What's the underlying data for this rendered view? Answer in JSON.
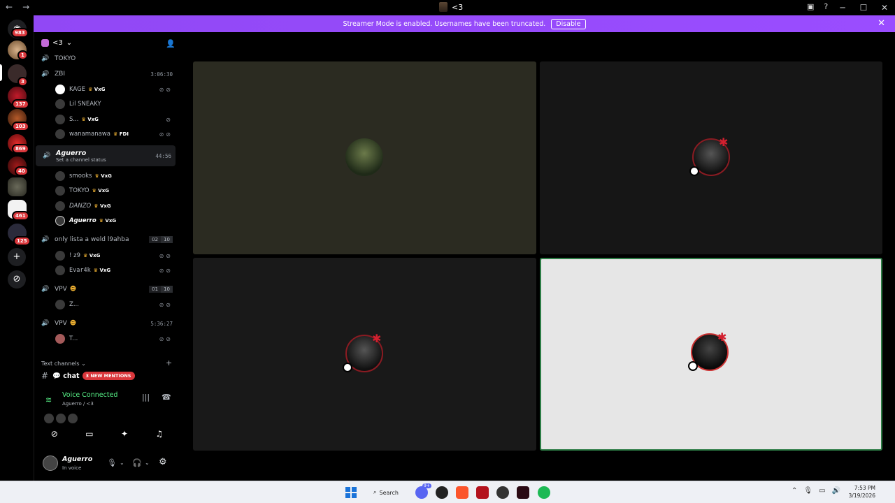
{
  "window": {
    "title": "<3",
    "nav_back": "←",
    "nav_forward": "→",
    "minimize": "─",
    "maximize": "☐",
    "close": "✕",
    "inbox_icon": "inbox-icon",
    "help_icon": "help-icon"
  },
  "banner": {
    "text": "Streamer Mode is enabled. Usernames have been truncated.",
    "disable_label": "Disable",
    "close": "✕",
    "color": "#9146ff"
  },
  "guild_rail": {
    "badges": [
      "983",
      "1",
      "3",
      "137",
      "103",
      "869",
      "40",
      "461",
      "125"
    ],
    "add_server": "+",
    "discover": "⊘"
  },
  "server": {
    "name": "<3",
    "chevron": "⌄",
    "invite_icon": "add-member-icon"
  },
  "channels": [
    {
      "name": "TOKYO",
      "kind": "partial"
    },
    {
      "name": "ZBI",
      "time": "3:06:30",
      "members": [
        {
          "name": "KAGE",
          "tag": "VxG"
        },
        {
          "name": "Lil SNEAKY",
          "tag": ""
        },
        {
          "name": "S...",
          "tag": "VxG"
        },
        {
          "name": "wanamanawa",
          "tag": "FDI"
        }
      ]
    },
    {
      "name": "Aguerro",
      "time": "44:56",
      "status": "Set a channel status",
      "members": [
        {
          "name": "smooks",
          "tag": "VxG"
        },
        {
          "name": "TOKYO",
          "tag": "VxG"
        },
        {
          "name": "DANZO",
          "tag": "VxG"
        },
        {
          "name": "Aguerro",
          "tag": "VxG"
        }
      ]
    },
    {
      "name": "only lista a weld l9ahba",
      "limit": [
        "02",
        "10"
      ],
      "members": [
        {
          "name": "! ᴢ9",
          "tag": "VxG"
        },
        {
          "name": "Evar4k",
          "tag": "VxG"
        }
      ]
    },
    {
      "name": "VPV",
      "limit": [
        "01",
        "10"
      ],
      "members": [
        {
          "name": "Z...",
          "tag": ""
        }
      ]
    },
    {
      "name": "VPV",
      "time": "5:36:27",
      "members": [
        {
          "name": "T...",
          "tag": ""
        }
      ]
    }
  ],
  "text_category": {
    "label": "Text channels",
    "plus": "+",
    "chat_name": "💬 chat",
    "mention_badge": "3 NEW MENTIONS",
    "hash": "#"
  },
  "voice": {
    "title": "Voice Connected",
    "subtitle": "Aguerro / <3"
  },
  "user_panel": {
    "name": "Aguerro",
    "status": "In voice",
    "settings_icon": "⚙"
  },
  "stage": {
    "tiles": [
      {
        "bg": "#2b2b21",
        "avatar": "#4a5a3a"
      },
      {
        "bg": "#161616",
        "avatar": "#2d2d2d"
      },
      {
        "bg": "#191919",
        "avatar": "#2a2a2a"
      },
      {
        "bg": "#e6e6e6",
        "avatar": "#1b1b1b",
        "speaking": true
      }
    ]
  },
  "taskbar": {
    "search_label": "Search",
    "time": "7:53 PM",
    "date": "3/19/2026",
    "discord_badge": "9+"
  }
}
